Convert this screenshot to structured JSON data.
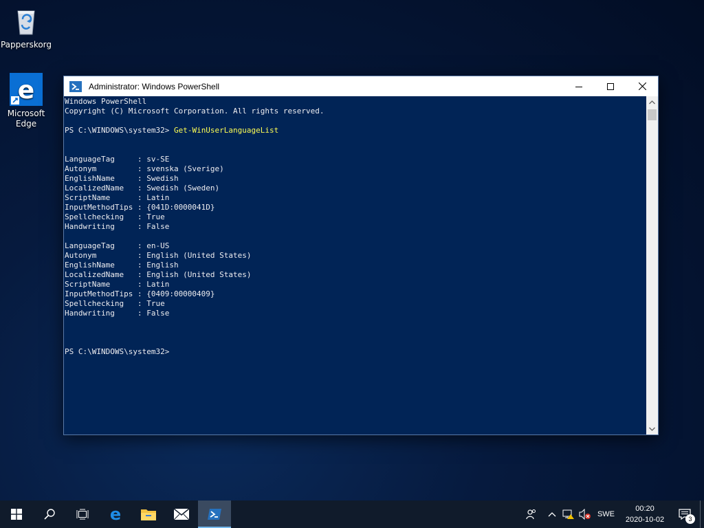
{
  "desktop": {
    "icons": [
      {
        "label": "Papperskorg",
        "icon": "recycle-bin-icon"
      },
      {
        "label": "Microsoft\nEdge",
        "icon": "edge-icon"
      }
    ]
  },
  "window": {
    "title": "Administrator: Windows PowerShell",
    "icon": "powershell-icon",
    "controls": [
      "minimize-icon",
      "maximize-icon",
      "close-icon"
    ]
  },
  "console": {
    "lines": [
      {
        "text": "Windows PowerShell"
      },
      {
        "text": "Copyright (C) Microsoft Corporation. All rights reserved."
      },
      {
        "text": ""
      },
      {
        "prompt": "PS C:\\WINDOWS\\system32> ",
        "command": "Get-WinUserLanguageList"
      },
      {
        "text": ""
      },
      {
        "text": ""
      },
      {
        "text": "LanguageTag     : sv-SE"
      },
      {
        "text": "Autonym         : svenska (Sverige)"
      },
      {
        "text": "EnglishName     : Swedish"
      },
      {
        "text": "LocalizedName   : Swedish (Sweden)"
      },
      {
        "text": "ScriptName      : Latin"
      },
      {
        "text": "InputMethodTips : {041D:0000041D}"
      },
      {
        "text": "Spellchecking   : True"
      },
      {
        "text": "Handwriting     : False"
      },
      {
        "text": ""
      },
      {
        "text": "LanguageTag     : en-US"
      },
      {
        "text": "Autonym         : English (United States)"
      },
      {
        "text": "EnglishName     : English"
      },
      {
        "text": "LocalizedName   : English (United States)"
      },
      {
        "text": "ScriptName      : Latin"
      },
      {
        "text": "InputMethodTips : {0409:00000409}"
      },
      {
        "text": "Spellchecking   : True"
      },
      {
        "text": "Handwriting     : False"
      },
      {
        "text": ""
      },
      {
        "text": ""
      },
      {
        "text": ""
      },
      {
        "text": "PS C:\\WINDOWS\\system32>"
      }
    ],
    "colors": {
      "background": "#012456",
      "text": "#eeedf0",
      "command": "#fefe54"
    }
  },
  "taskbar": {
    "apps": [
      {
        "name": "start-button",
        "icon": "windows-logo-icon"
      },
      {
        "name": "search-button",
        "icon": "search-icon"
      },
      {
        "name": "task-view-button",
        "icon": "task-view-icon"
      },
      {
        "name": "edge-taskbar-button",
        "icon": "edge-icon"
      },
      {
        "name": "file-explorer-button",
        "icon": "folder-icon"
      },
      {
        "name": "mail-button",
        "icon": "mail-icon"
      },
      {
        "name": "powershell-taskbar-button",
        "icon": "powershell-icon",
        "active": true
      }
    ],
    "tray": {
      "language": "SWE",
      "time": "00:20",
      "date": "2020-10-02",
      "notification_count": "3"
    }
  }
}
